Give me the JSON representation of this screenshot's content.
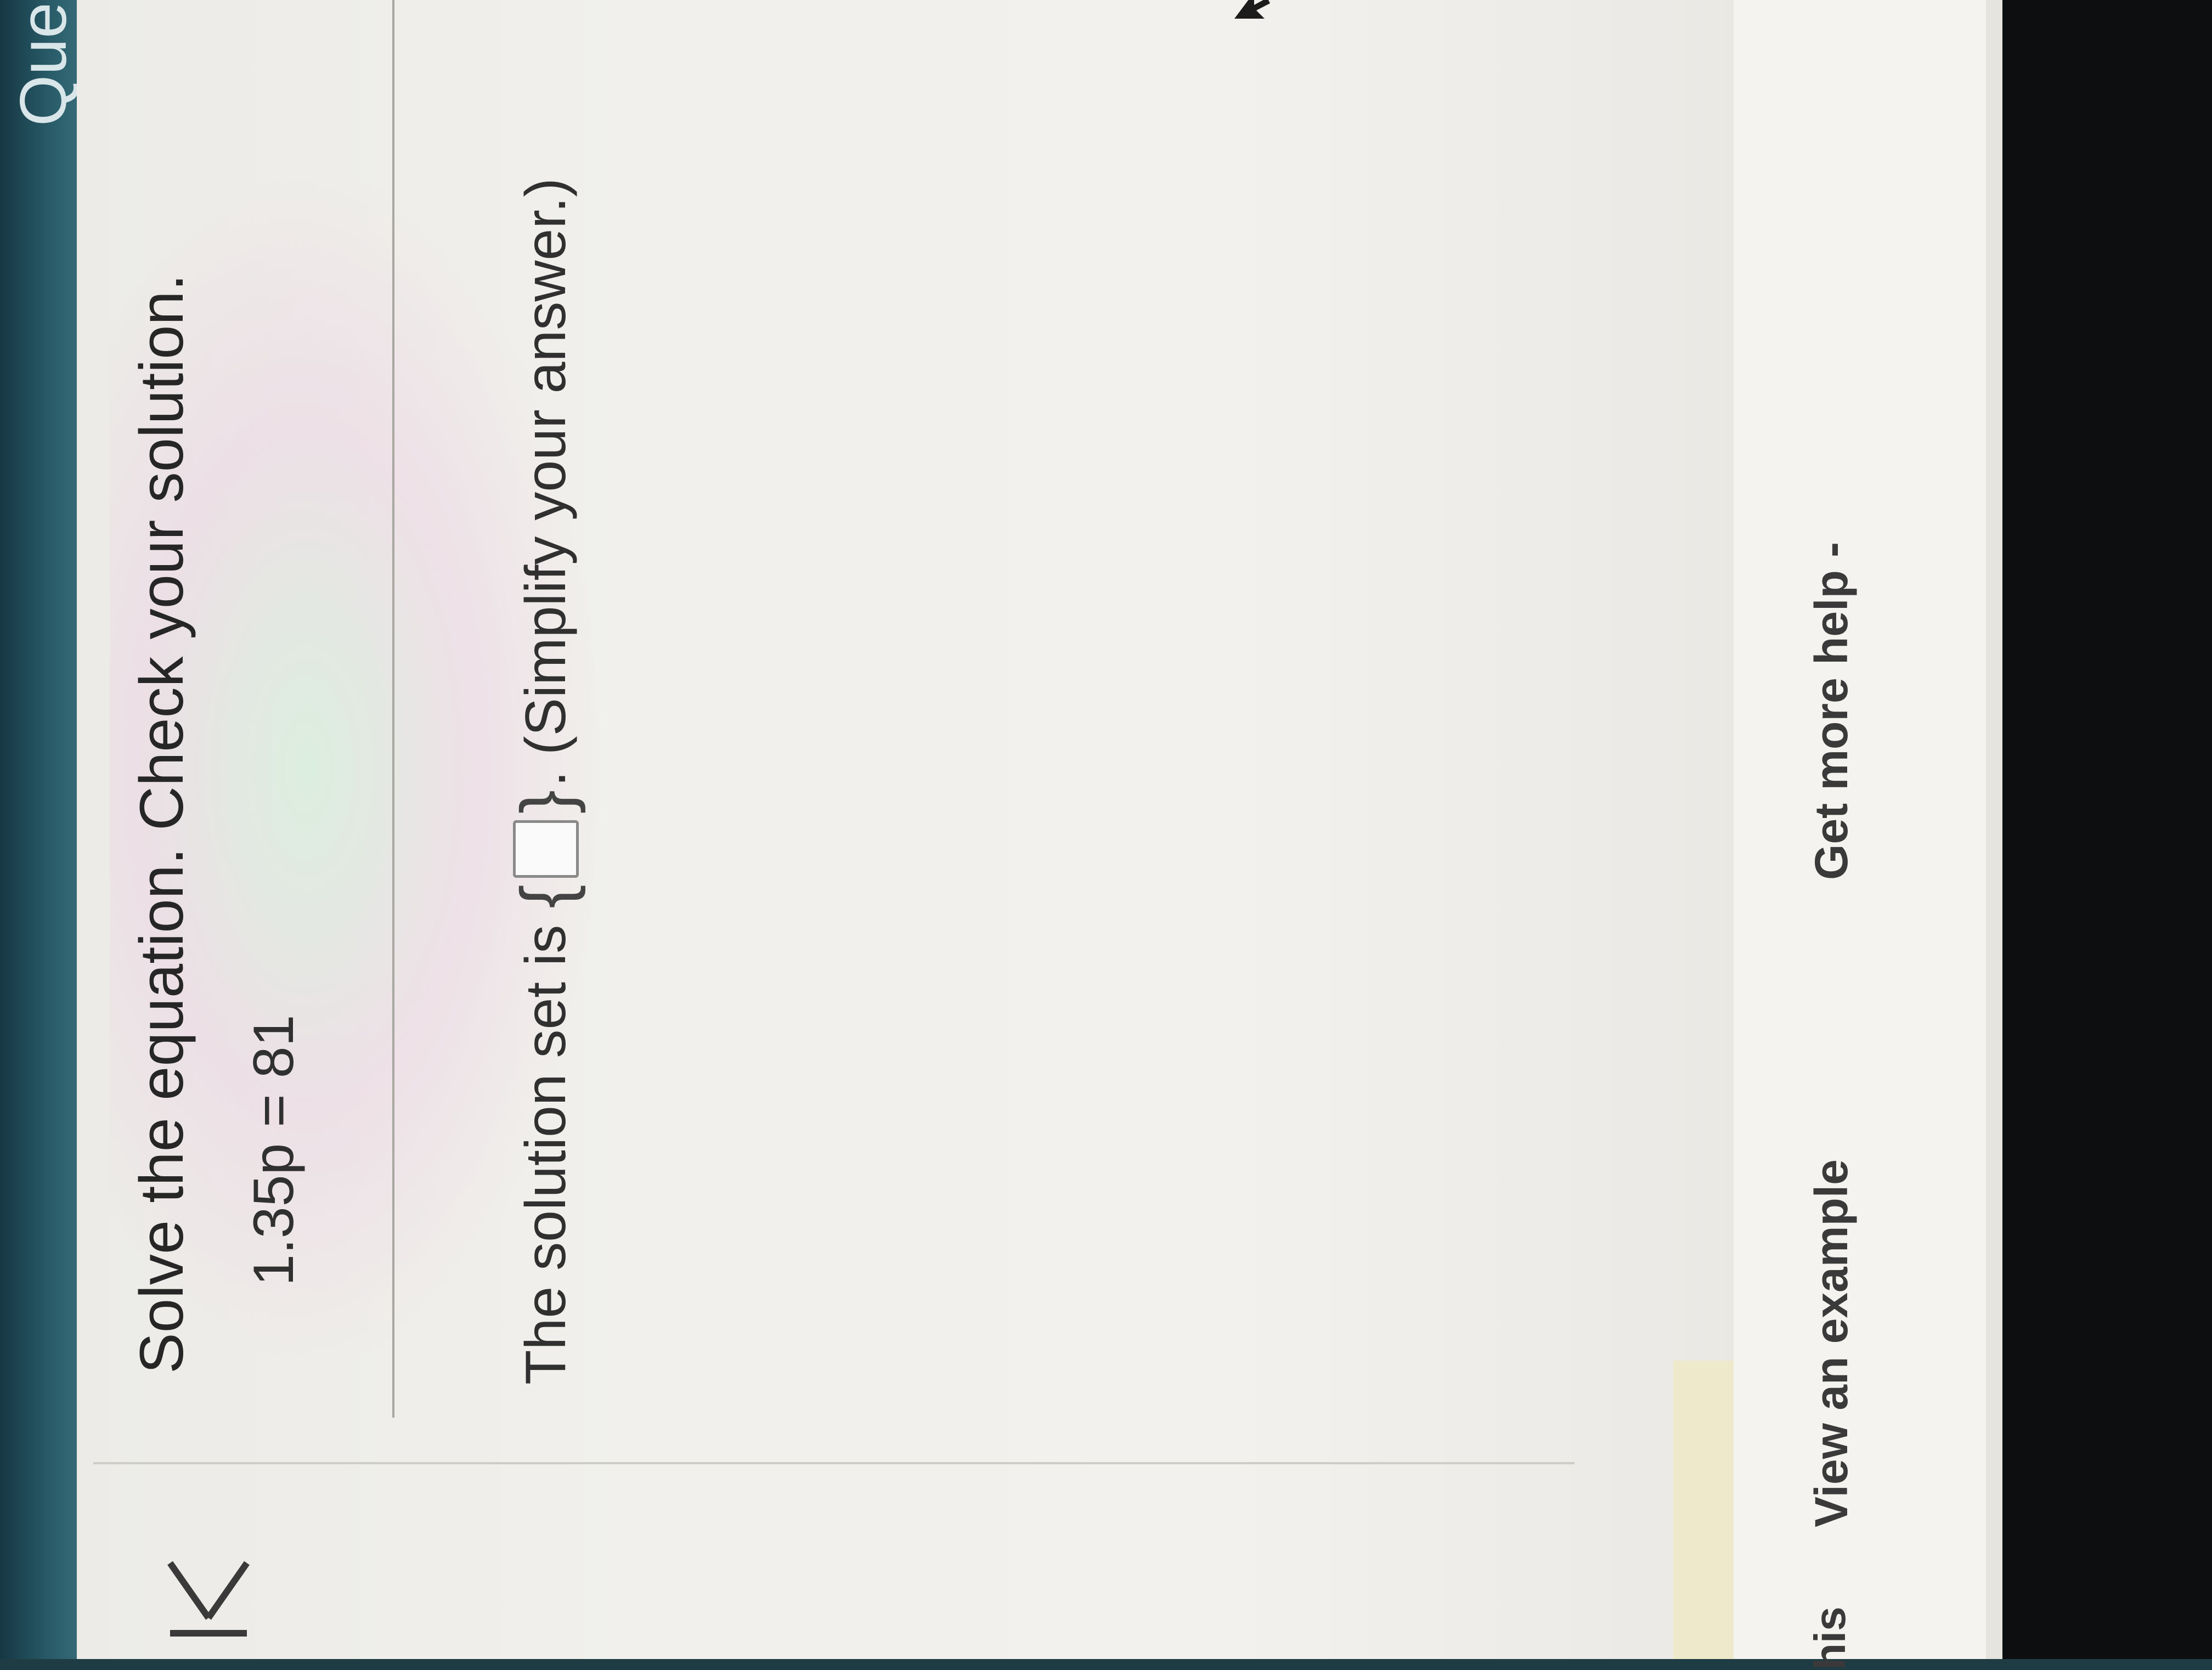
{
  "question": {
    "instruction": "Solve the equation. Check your solution.",
    "equation": "1.35p = 81",
    "answer_prefix": "The solution set is",
    "brace_open": "{",
    "brace_close": "}",
    "answer_value": "",
    "answer_suffix": ". (Simplify your answer.)"
  },
  "footer": {
    "partial_label": "his",
    "view_example": "View an example",
    "get_more_help": "Get more help -"
  },
  "header": {
    "partial_title": "Questi"
  },
  "colors": {
    "teal_bar": "#2a5d6a",
    "screen_bg": "#f1f0ec",
    "text": "#2b2b2b",
    "cream_strip": "#efe9cc"
  },
  "icons": {
    "back": "back-to-start-icon",
    "cursor": "mouse-pointer-icon"
  }
}
